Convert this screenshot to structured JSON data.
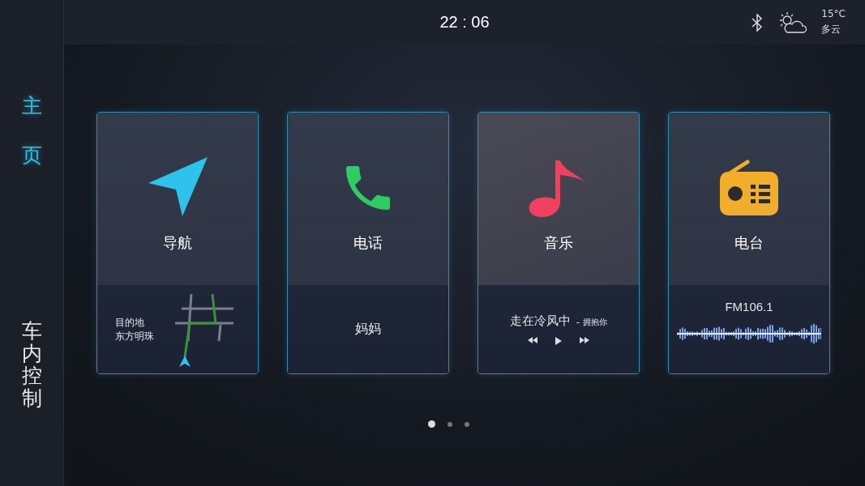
{
  "sidebar": {
    "items": [
      {
        "label": "主页",
        "selected": true
      },
      {
        "label": "车内控制",
        "selected": false
      }
    ]
  },
  "status_bar": {
    "time": "22 : 06",
    "temperature": "15°C",
    "weather": "多云"
  },
  "cards": [
    {
      "kind": "navigation",
      "title": "导航",
      "lines": [
        "目的地",
        "东方明珠"
      ]
    },
    {
      "kind": "phone",
      "title": "电话",
      "contact": "妈妈"
    },
    {
      "kind": "music",
      "title": "音乐",
      "song": "走在冷风中",
      "artist": "– 拥抱你"
    },
    {
      "kind": "radio",
      "title": "电台",
      "station": "FM106.1"
    }
  ],
  "pages": [
    {
      "selected": true
    },
    {
      "selected": false
    },
    {
      "selected": false
    }
  ]
}
